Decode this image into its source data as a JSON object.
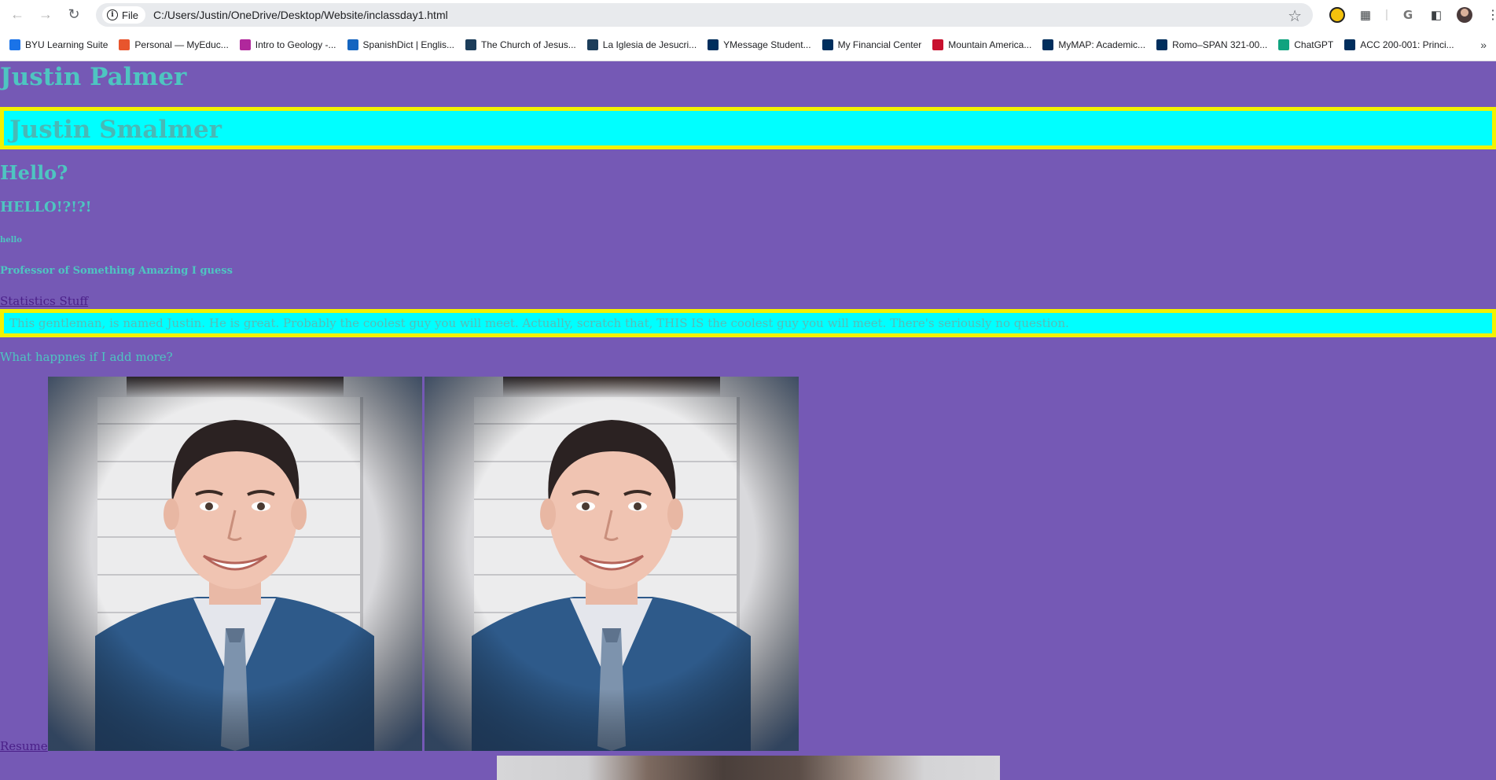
{
  "browser": {
    "chip_label": "File",
    "url": "C:/Users/Justin/OneDrive/Desktop/Website/inclassday1.html",
    "bookmarks": [
      {
        "label": "BYU Learning Suite",
        "icon": "byu-learning-suite-icon",
        "color": "#1a73e8"
      },
      {
        "label": "Personal — MyEduc...",
        "icon": "myeduc-icon",
        "color": "#e8552d"
      },
      {
        "label": "Intro to Geology -...",
        "icon": "geology-icon",
        "color": "#b0289c"
      },
      {
        "label": "SpanishDict | Englis...",
        "icon": "spanishdict-icon",
        "color": "#1565c0"
      },
      {
        "label": "The Church of Jesus...",
        "icon": "church-icon",
        "color": "#1c3d5a"
      },
      {
        "label": "La Iglesia de Jesucri...",
        "icon": "iglesia-icon",
        "color": "#1c3d5a"
      },
      {
        "label": "YMessage Student...",
        "icon": "byu-y-icon",
        "color": "#002e5d"
      },
      {
        "label": "My Financial Center",
        "icon": "byu-y-icon",
        "color": "#002e5d"
      },
      {
        "label": "Mountain America...",
        "icon": "mountain-america-icon",
        "color": "#c8102e"
      },
      {
        "label": "MyMAP: Academic...",
        "icon": "byu-y-icon",
        "color": "#002e5d"
      },
      {
        "label": "Romo–SPAN 321-00...",
        "icon": "byu-y-icon",
        "color": "#002e5d"
      },
      {
        "label": "ChatGPT",
        "icon": "chatgpt-icon",
        "color": "#10a37f"
      },
      {
        "label": "ACC 200-001: Princi...",
        "icon": "byu-y-icon",
        "color": "#002e5d"
      }
    ]
  },
  "page": {
    "heading1": "Justin Palmer",
    "heading1_boxed": "Justin Smalmer",
    "heading2": "Hello?",
    "heading3": "HELLO!?!?!",
    "heading6": "hello",
    "heading5": "Professor of Something Amazing I guess",
    "stats_link": "Statistics Stuff",
    "boxed_paragraph": "This gentleman, is named Justin. He is great. Probably the coolest guy you will meet. Actually, scratch that, THIS IS the coolest guy you will meet. There's seriously no question.",
    "paragraph2": "What happnes if I add more?",
    "resume_link": "Resume",
    "colors": {
      "background": "#7559b5",
      "text": "#4ec5c1",
      "box_fill": "#00ffff",
      "box_border": "#f2f200",
      "link": "#4a1f88"
    }
  }
}
